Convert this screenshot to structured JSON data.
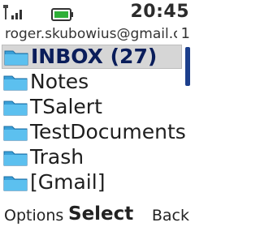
{
  "status_bar": {
    "signal_icon": "signal-bars-icon",
    "battery_icon": "battery-icon",
    "battery_color": "#2eaf37",
    "time": "20:45"
  },
  "account": {
    "email": "roger.skubowius@gmail.c...",
    "count": "1"
  },
  "folders": [
    {
      "label": "INBOX (27)",
      "selected": true
    },
    {
      "label": "Notes"
    },
    {
      "label": "TSalert"
    },
    {
      "label": "TestDocuments"
    },
    {
      "label": "Trash"
    },
    {
      "label": "[Gmail]"
    }
  ],
  "softkeys": {
    "left": "Options",
    "middle": "Select",
    "right": "Back"
  },
  "colors": {
    "folder_icon": "#3aa0d8",
    "scroll_thumb": "#1c3f8c",
    "selected_text": "#0a1d5a"
  }
}
